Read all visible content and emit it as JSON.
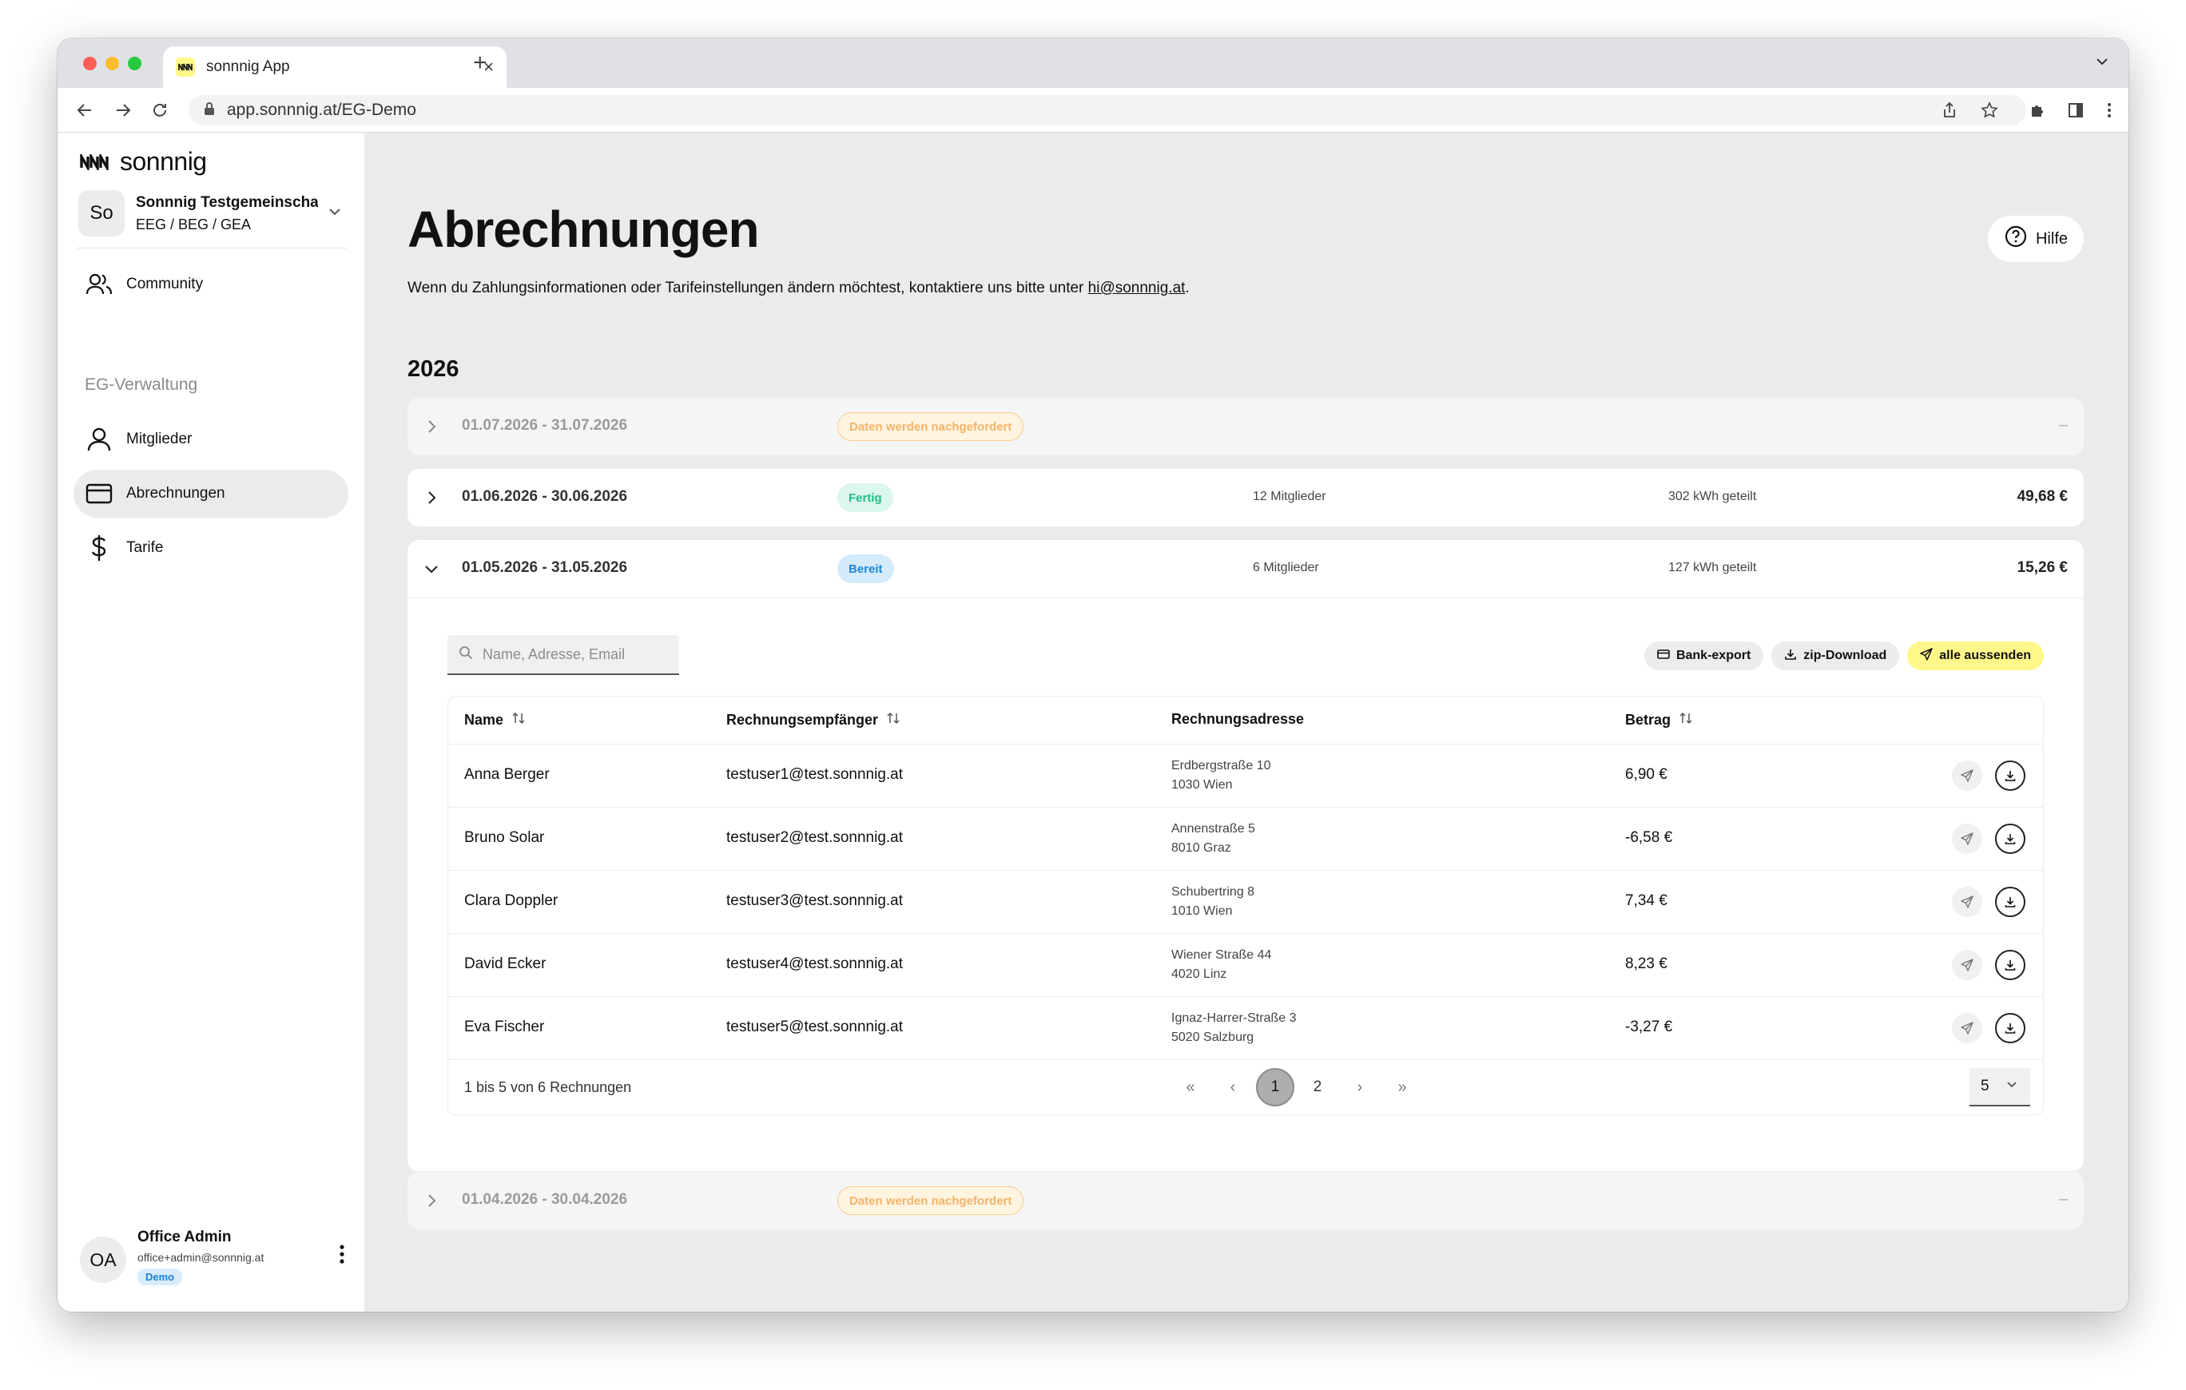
{
  "browser": {
    "tab_title": "sonnnig App",
    "url": "app.sonnnig.at/EG-Demo",
    "favicon_text": "NNN"
  },
  "sidebar": {
    "logo_text": "sonnnig",
    "org": {
      "initials": "So",
      "name": "Sonnnig Testgemeinscha",
      "sub": "EEG / BEG / GEA"
    },
    "community_label": "Community",
    "section_label": "EG-Verwaltung",
    "items": [
      {
        "label": "Mitglieder",
        "icon": "user-icon"
      },
      {
        "label": "Abrechnungen",
        "icon": "credit-card-icon",
        "active": true
      },
      {
        "label": "Tarife",
        "icon": "dollar-icon"
      }
    ],
    "user": {
      "initials": "OA",
      "name": "Office Admin",
      "email": "office+admin@sonnnig.at",
      "badge": "Demo"
    }
  },
  "main": {
    "title": "Abrechnungen",
    "subtitle_prefix": "Wenn du Zahlungsinformationen oder Tarifeinstellungen ändern möchtest, kontaktiere uns bitte unter ",
    "subtitle_link": "hi@sonnnig.at",
    "subtitle_suffix": ".",
    "help_label": "Hilfe",
    "year": "2026",
    "periods": [
      {
        "date": "01.07.2026 - 31.07.2026",
        "status": "Daten werden nachgefordert",
        "status_type": "warn",
        "members": "",
        "kwh": "",
        "amount": "–"
      },
      {
        "date": "01.06.2026 - 30.06.2026",
        "status": "Fertig",
        "status_type": "done",
        "members": "12 Mitglieder",
        "kwh": "302 kWh geteilt",
        "amount": "49,68 €"
      },
      {
        "date": "01.05.2026 - 31.05.2026",
        "status": "Bereit",
        "status_type": "ready",
        "members": "6 Mitglieder",
        "kwh": "127 kWh geteilt",
        "amount": "15,26 €",
        "expanded": true
      },
      {
        "date": "01.04.2026 - 30.04.2026",
        "status": "Daten werden nachgefordert",
        "status_type": "warn",
        "members": "",
        "kwh": "",
        "amount": "–"
      }
    ],
    "detail": {
      "search_placeholder": "Name, Adresse, Email",
      "actions": {
        "bank_export": "Bank-export",
        "zip_download": "zip-Download",
        "send_all": "alle aussenden"
      },
      "columns": {
        "name": "Name",
        "recipient": "Rechnungsempfänger",
        "address": "Rechnungsadresse",
        "amount": "Betrag"
      },
      "rows": [
        {
          "name": "Anna Berger",
          "email": "testuser1@test.sonnnig.at",
          "street": "Erdbergstraße 10",
          "city": "1030 Wien",
          "amount": "6,90 €"
        },
        {
          "name": "Bruno Solar",
          "email": "testuser2@test.sonnnig.at",
          "street": "Annenstraße 5",
          "city": "8010 Graz",
          "amount": "-6,58 €"
        },
        {
          "name": "Clara Doppler",
          "email": "testuser3@test.sonnnig.at",
          "street": "Schubertring 8",
          "city": "1010 Wien",
          "amount": "7,34 €"
        },
        {
          "name": "David Ecker",
          "email": "testuser4@test.sonnnig.at",
          "street": "Wiener Straße 44",
          "city": "4020 Linz",
          "amount": "8,23 €"
        },
        {
          "name": "Eva Fischer",
          "email": "testuser5@test.sonnnig.at",
          "street": "Ignaz-Harrer-Straße 3",
          "city": "5020 Salzburg",
          "amount": "-3,27 €"
        }
      ],
      "count_text": "1 bis 5 von 6 Rechnungen",
      "pager": {
        "first": "«",
        "prev": "‹",
        "pages": [
          "1",
          "2"
        ],
        "current": "1",
        "next": "›",
        "last": "»"
      },
      "per_page": "5"
    }
  },
  "colors": {
    "accent_yellow": "#fff78a",
    "warn": "#f5b36a",
    "done": "#1fbf86",
    "ready": "#1c86d8"
  }
}
